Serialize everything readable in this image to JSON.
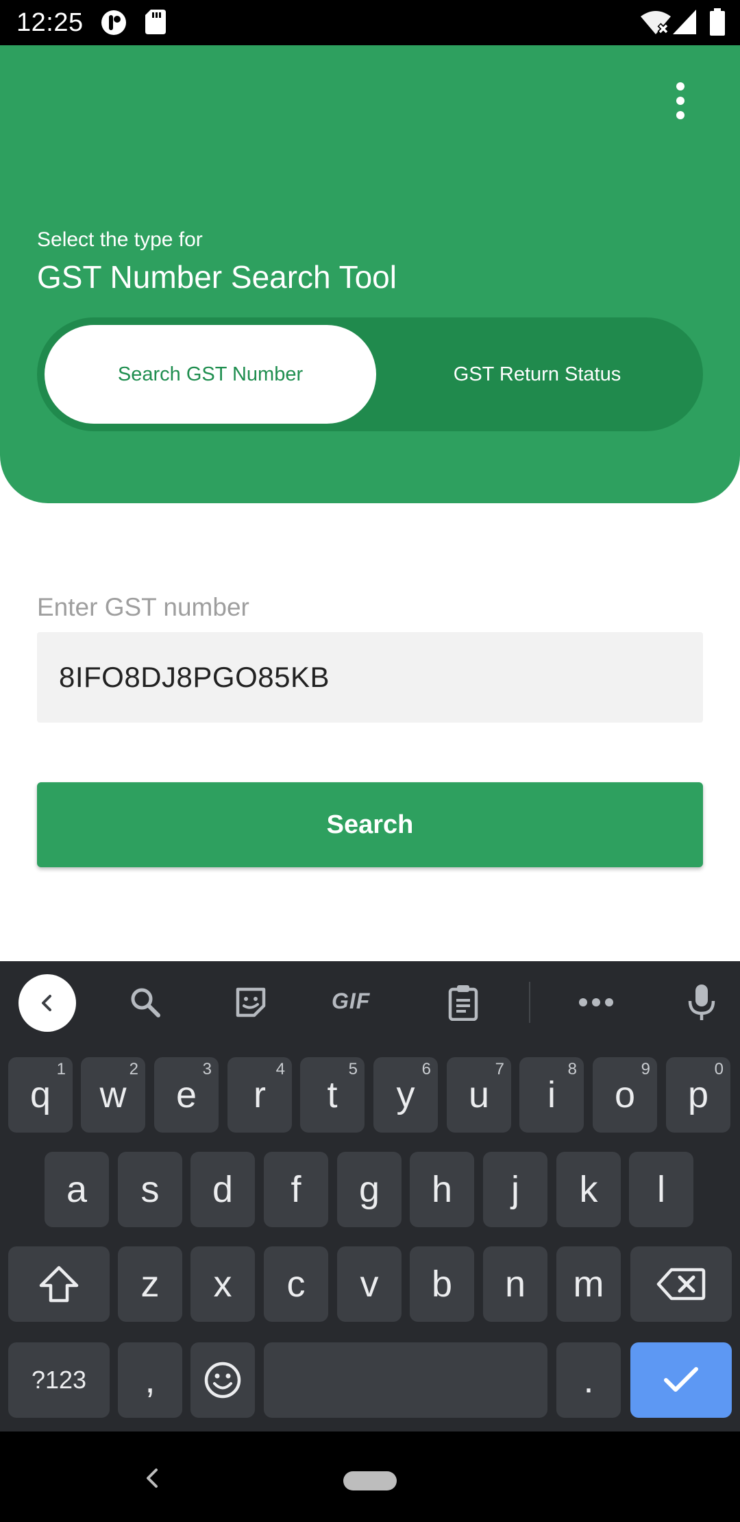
{
  "status_bar": {
    "time": "12:25",
    "icons": [
      "app-notification-icon",
      "sd-card-icon",
      "wifi-off-icon",
      "signal-icon",
      "battery-icon"
    ]
  },
  "header": {
    "subtitle": "Select the type for",
    "title": "GST Number Search Tool",
    "menu_icon": "more-vert-icon",
    "toggle": {
      "options": [
        "Search GST Number",
        "GST Return Status"
      ],
      "selected": "Search GST Number"
    },
    "bg_color": "#2ea05f"
  },
  "form": {
    "label": "Enter GST number",
    "value": "8IFO8DJ8PGO85KB",
    "button_label": "Search",
    "button_color": "#2ea05f"
  },
  "keyboard": {
    "toolbar_icons": [
      "chevron-left-icon",
      "search-icon",
      "sticker-icon",
      "gif-icon",
      "clipboard-icon",
      "more-horiz-icon",
      "mic-icon"
    ],
    "gif_label": "GIF",
    "row1": [
      {
        "k": "q",
        "h": "1"
      },
      {
        "k": "w",
        "h": "2"
      },
      {
        "k": "e",
        "h": "3"
      },
      {
        "k": "r",
        "h": "4"
      },
      {
        "k": "t",
        "h": "5"
      },
      {
        "k": "y",
        "h": "6"
      },
      {
        "k": "u",
        "h": "7"
      },
      {
        "k": "i",
        "h": "8"
      },
      {
        "k": "o",
        "h": "9"
      },
      {
        "k": "p",
        "h": "0"
      }
    ],
    "row2": [
      "a",
      "s",
      "d",
      "f",
      "g",
      "h",
      "j",
      "k",
      "l"
    ],
    "row3": [
      "z",
      "x",
      "c",
      "v",
      "b",
      "n",
      "m"
    ],
    "symbols_label": "?123",
    "comma": ",",
    "period": ".",
    "enter_color": "#5d98f3"
  },
  "navbar": {
    "icons": [
      "back-icon",
      "home-pill-icon"
    ]
  }
}
